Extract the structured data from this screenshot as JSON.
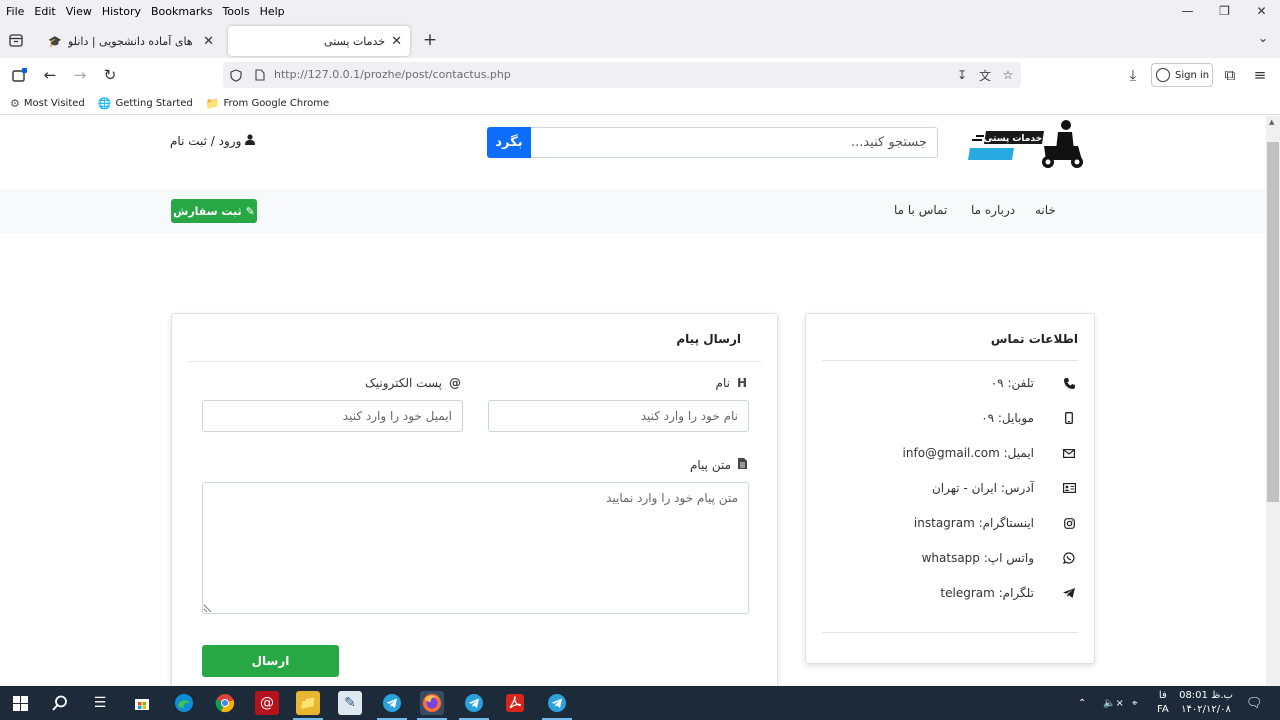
{
  "browser": {
    "menu": [
      "File",
      "Edit",
      "View",
      "History",
      "Bookmarks",
      "Tools",
      "Help"
    ],
    "tabs": [
      {
        "title": "پروژه های آماده دانشجویی | دانلو",
        "active": false
      },
      {
        "title": "خدمات پستی",
        "active": true
      }
    ],
    "url": "http://127.0.0.1/prozhe/post/contactus.php",
    "sign_in": "Sign in",
    "bookmarks": [
      "Most Visited",
      "Getting Started",
      "From Google Chrome"
    ]
  },
  "site": {
    "logo_text": "خدمات پستی",
    "search_placeholder": "جستجو کنید...",
    "search_button": "بگرد",
    "login_label": "ورود / ثبت نام",
    "nav": [
      "خانه",
      "درباره ما",
      "تماس با ما"
    ],
    "order_button": "ثبت سفارش"
  },
  "contact_info": {
    "title": "اطلاعات تماس",
    "rows": [
      {
        "icon": "phone-icon",
        "text": "تلفن: ۰۹"
      },
      {
        "icon": "mobile-icon",
        "text": "موبایل: ۰۹"
      },
      {
        "icon": "envelope-icon",
        "text": "ایمیل: info@gmail.com"
      },
      {
        "icon": "address-card-icon",
        "text": "آدرس: ایران - تهران"
      },
      {
        "icon": "instagram-icon",
        "text": "اینستاگرام: instagram"
      },
      {
        "icon": "whatsapp-icon",
        "text": "واتس اپ: whatsapp"
      },
      {
        "icon": "telegram-icon",
        "text": "تلگرام: telegram"
      }
    ]
  },
  "message_form": {
    "title": "ارسال پیام",
    "name_label": "نام",
    "name_placeholder": "نام خود را وارد کنید",
    "email_label": "پست الکترونیک",
    "email_placeholder": "ایمیل خود را وارد کنید",
    "message_label": "متن پیام",
    "message_placeholder": "متن پیام خود را وارد نمایید",
    "submit": "ارسال"
  },
  "taskbar": {
    "time": "08:01 ب.ظ",
    "date": "۱۴۰۲/۱۲/۰۸",
    "lang": "FA",
    "lang_script": "فا"
  },
  "colors": {
    "primary": "#0d6efd",
    "success": "#28a745",
    "taskbar": "#1c2a3a"
  }
}
